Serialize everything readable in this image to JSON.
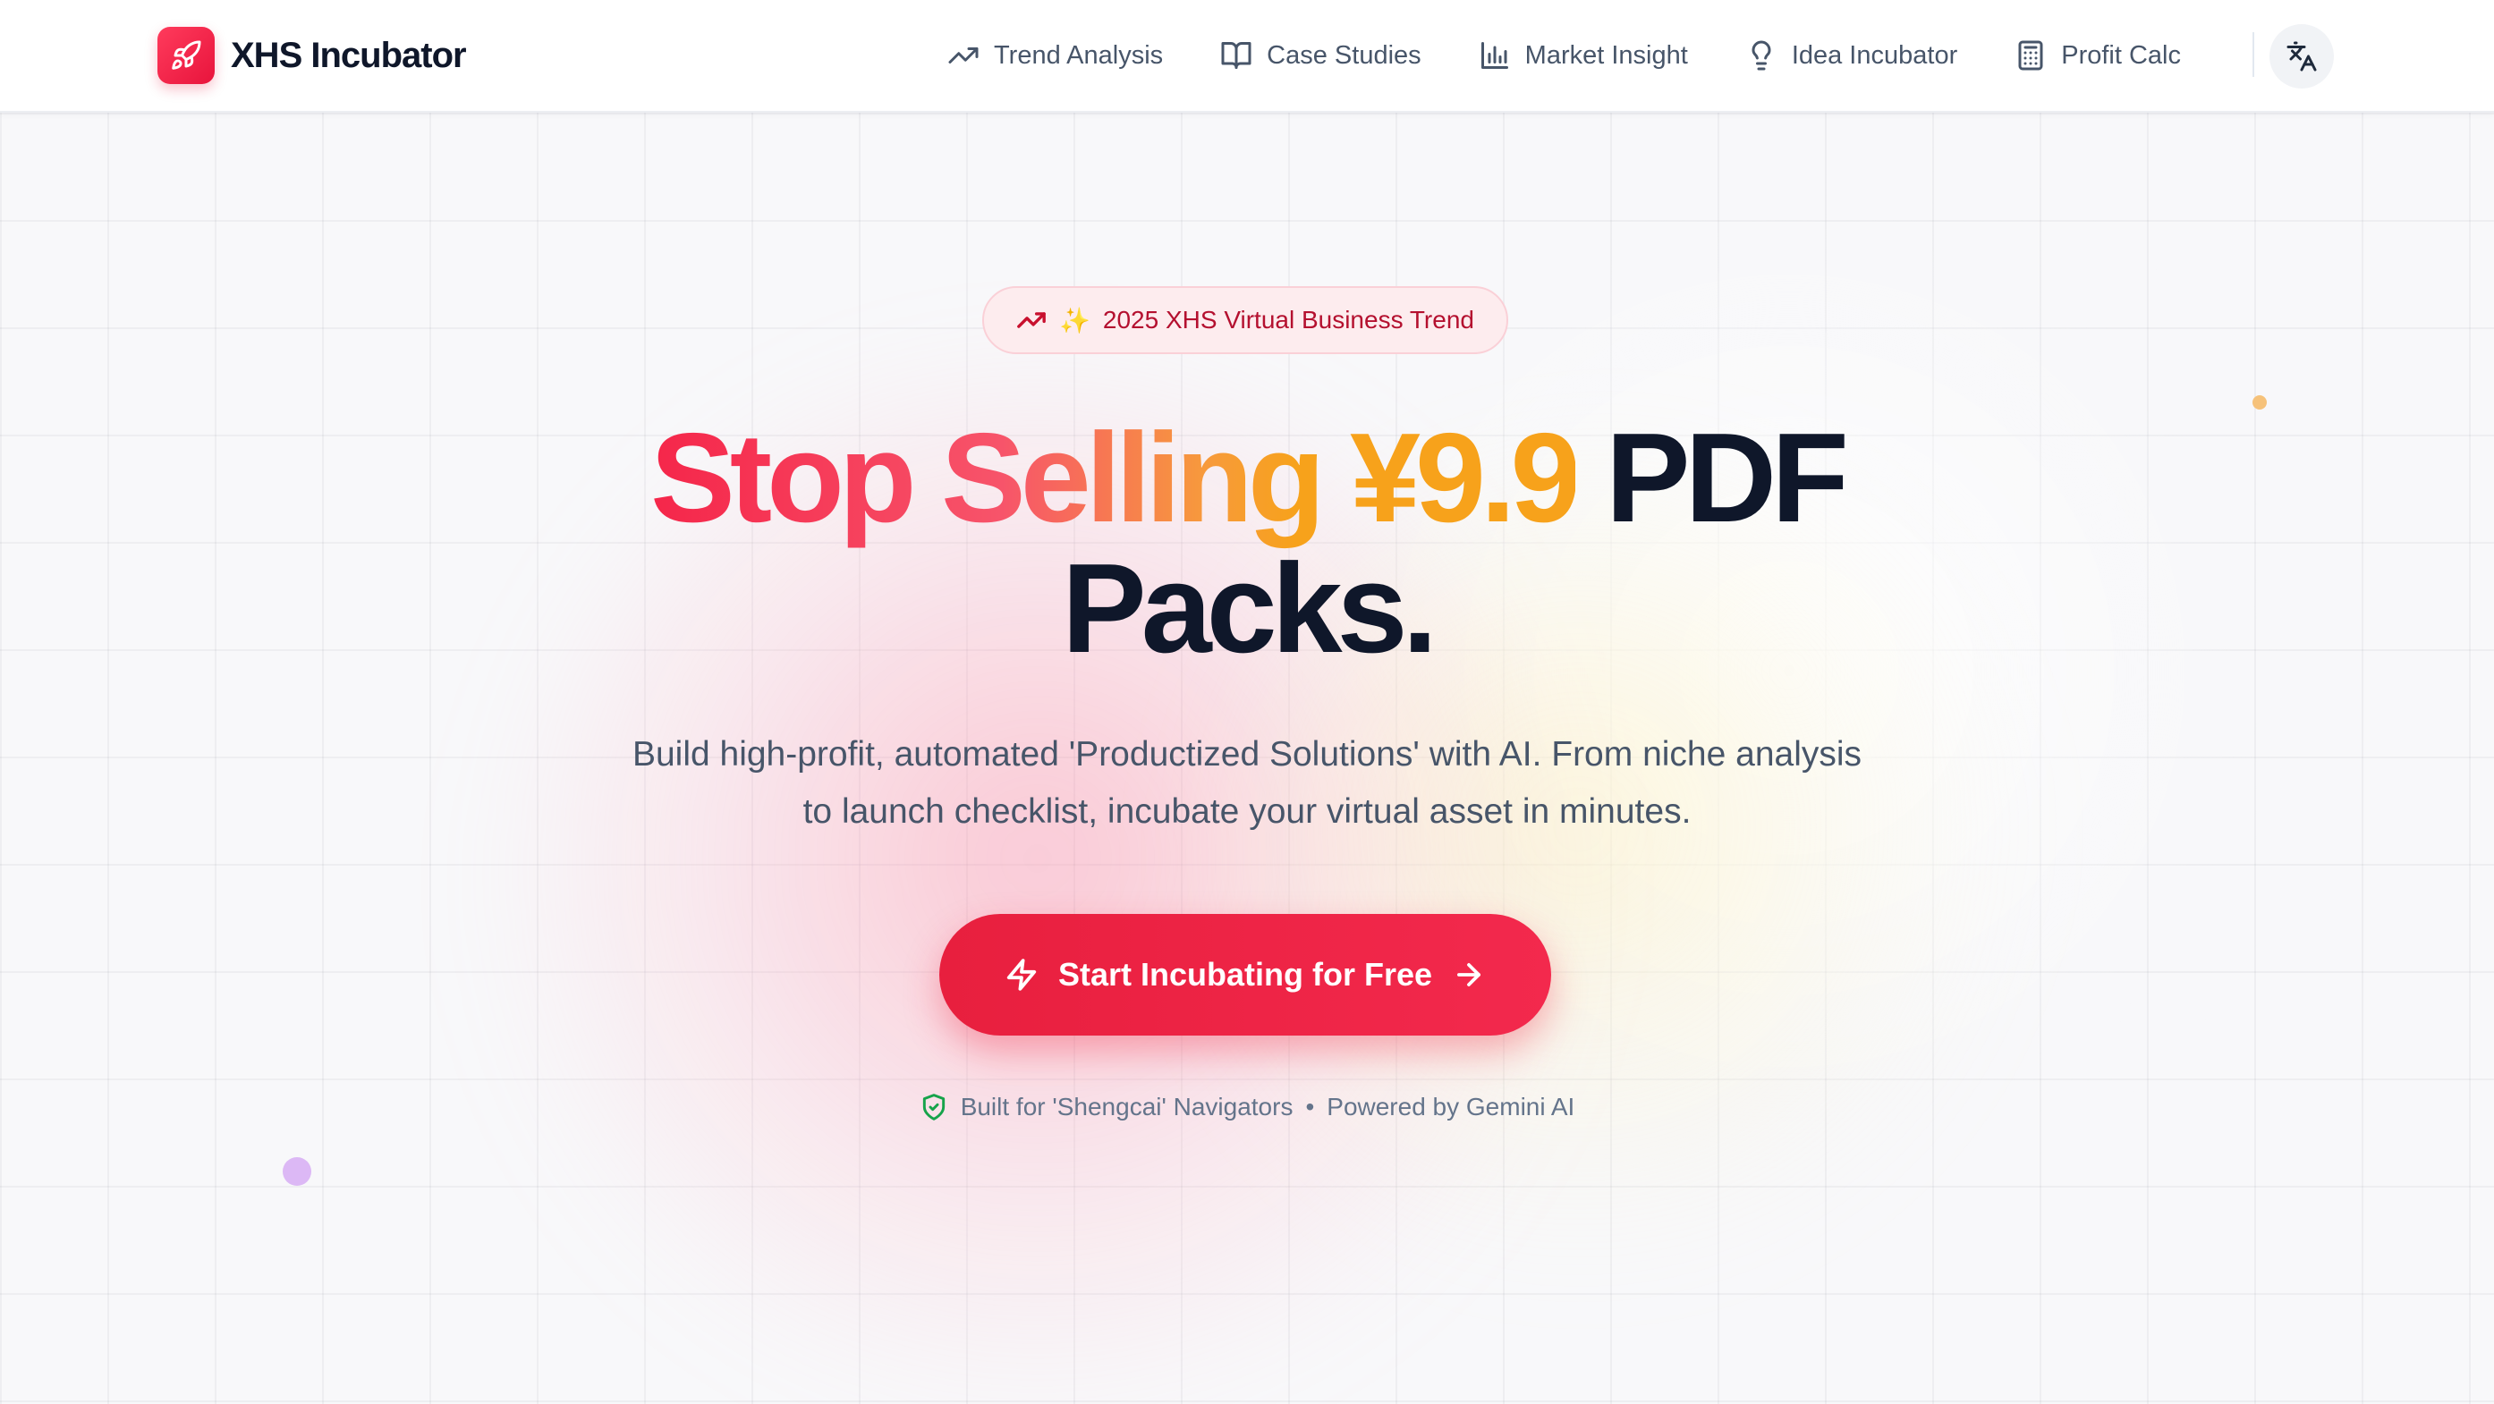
{
  "brand": {
    "name": "XHS Incubator",
    "logo_icon": "rocket-icon",
    "accent": "#e8143c"
  },
  "nav": {
    "items": [
      {
        "label": "Trend Analysis",
        "icon": "trend-up-icon"
      },
      {
        "label": "Case Studies",
        "icon": "book-open-icon"
      },
      {
        "label": "Market Insight",
        "icon": "bar-chart-icon"
      },
      {
        "label": "Idea Incubator",
        "icon": "lightbulb-icon"
      },
      {
        "label": "Profit Calc",
        "icon": "calculator-icon"
      }
    ],
    "language_icon": "translate-icon"
  },
  "hero": {
    "badge": {
      "spark": "✨",
      "text": "2025 XHS Virtual Business Trend"
    },
    "headline": {
      "part1": "Stop Selling ¥9.9",
      "part2": "PDF",
      "line2": "Packs."
    },
    "subtitle": "Build high-profit, automated 'Productized Solutions' with AI. From niche analysis to launch checklist, incubate your virtual asset in minutes.",
    "cta": {
      "label": "Start Incubating for Free"
    },
    "footnote": {
      "left": "Built for 'Shengcai' Navigators",
      "separator": "•",
      "right": "Powered by Gemini AI"
    }
  },
  "colors": {
    "primary": "#e81f3e",
    "gradient_start": "#f5264a",
    "gradient_end": "#f7a21b",
    "text_dark": "#0f172a",
    "text_muted": "#475569",
    "shield_green": "#16a34a"
  }
}
